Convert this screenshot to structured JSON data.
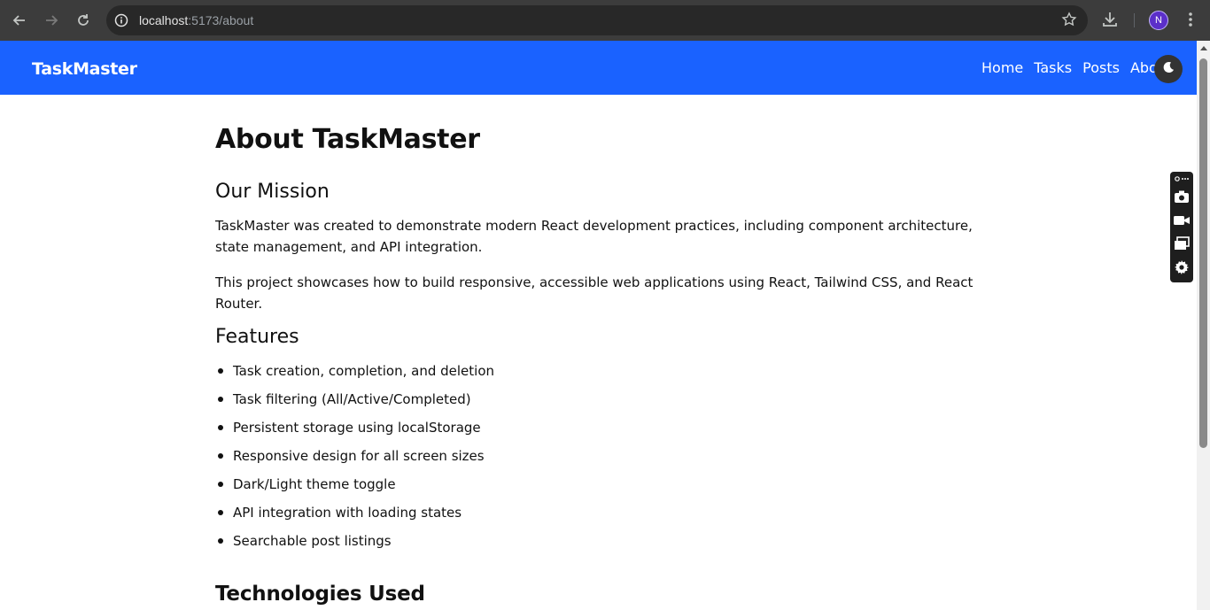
{
  "browser": {
    "url_host": "localhost",
    "url_path": ":5173/about",
    "profile_initial": "N"
  },
  "app": {
    "brand": "TaskMaster",
    "nav": [
      "Home",
      "Tasks",
      "Posts",
      "About"
    ]
  },
  "page": {
    "title": "About TaskMaster",
    "mission_heading": "Our Mission",
    "mission_p1": "TaskMaster was created to demonstrate modern React development practices, including component architecture, state management, and API integration.",
    "mission_p2": "This project showcases how to build responsive, accessible web applications using React, Tailwind CSS, and React Router.",
    "features_heading": "Features",
    "features": [
      "Task creation, completion, and deletion",
      "Task filtering (All/Active/Completed)",
      "Persistent storage using localStorage",
      "Responsive design for all screen sizes",
      "Dark/Light theme toggle",
      "API integration with loading states",
      "Searchable post listings"
    ],
    "tech_heading": "Technologies Used"
  },
  "colors": {
    "appbar": "#1a62ff",
    "chrome": "#3c3c3c"
  },
  "icons": [
    "back-arrow-icon",
    "forward-arrow-icon",
    "reload-icon",
    "site-info-icon",
    "bookmark-star-icon",
    "download-icon",
    "kebab-menu-icon",
    "moon-icon",
    "camera-icon",
    "video-icon",
    "windows-icon",
    "gear-icon"
  ]
}
